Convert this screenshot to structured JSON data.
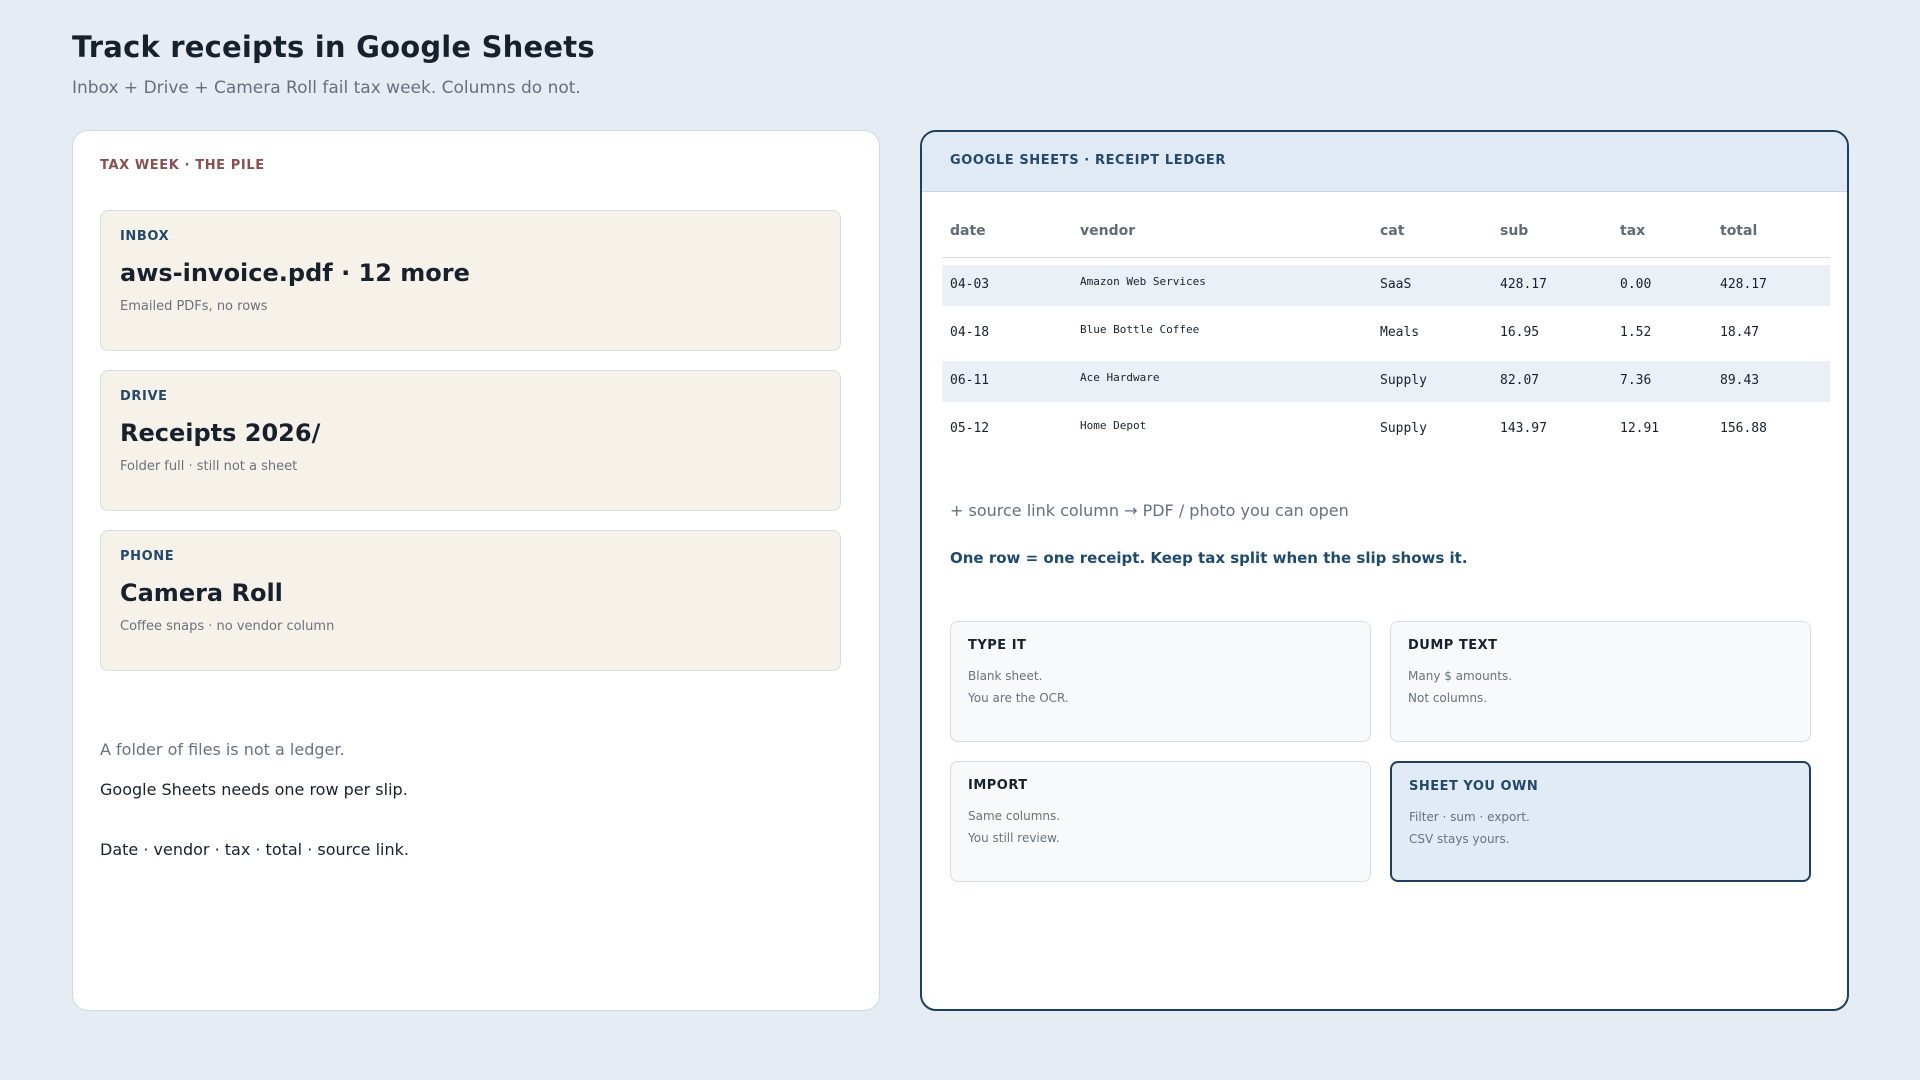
{
  "header": {
    "title": "Track receipts in Google Sheets",
    "subtitle": "Inbox + Drive + Camera Roll fail tax week. Columns do not."
  },
  "left": {
    "kicker": "TAX WEEK · THE PILE",
    "cards": [
      {
        "kicker": "INBOX",
        "title": "aws-invoice.pdf · 12 more",
        "sub": "Emailed PDFs, no rows"
      },
      {
        "kicker": "DRIVE",
        "title": "Receipts 2026/",
        "sub": "Folder full · still not a sheet"
      },
      {
        "kicker": "PHONE",
        "title": "Camera Roll",
        "sub": "Coffee snaps · no vendor column"
      }
    ],
    "notes": [
      "A folder of files is not a ledger.",
      "Google Sheets needs one row per slip.",
      "Date · vendor · tax · total · source link."
    ]
  },
  "right": {
    "kicker": "GOOGLE SHEETS · RECEIPT LEDGER",
    "columns": [
      "date",
      "vendor",
      "cat",
      "sub",
      "tax",
      "total"
    ],
    "rows": [
      [
        "04-03",
        "Amazon Web Services",
        "SaaS",
        "428.17",
        "0.00",
        "428.17"
      ],
      [
        "04-18",
        "Blue Bottle Coffee",
        "Meals",
        "16.95",
        "1.52",
        "18.47"
      ],
      [
        "06-11",
        "Ace Hardware",
        "Supply",
        "82.07",
        "7.36",
        "89.43"
      ],
      [
        "05-12",
        "Home Depot",
        "Supply",
        "143.97",
        "12.91",
        "156.88"
      ]
    ],
    "source_note": "+ source link column → PDF / photo you can open",
    "rule_note": "One row = one receipt. Keep tax split when the slip shows it.",
    "options": [
      {
        "title": "TYPE IT",
        "line1": "Blank sheet.",
        "line2": "You are the OCR."
      },
      {
        "title": "DUMP TEXT",
        "line1": "Many $ amounts.",
        "line2": "Not columns."
      },
      {
        "title": "IMPORT",
        "line1": "Same columns.",
        "line2": "You still review."
      },
      {
        "title": "SHEET YOU OWN",
        "line1": "Filter · sum · export.",
        "line2": "CSV stays yours."
      }
    ]
  }
}
